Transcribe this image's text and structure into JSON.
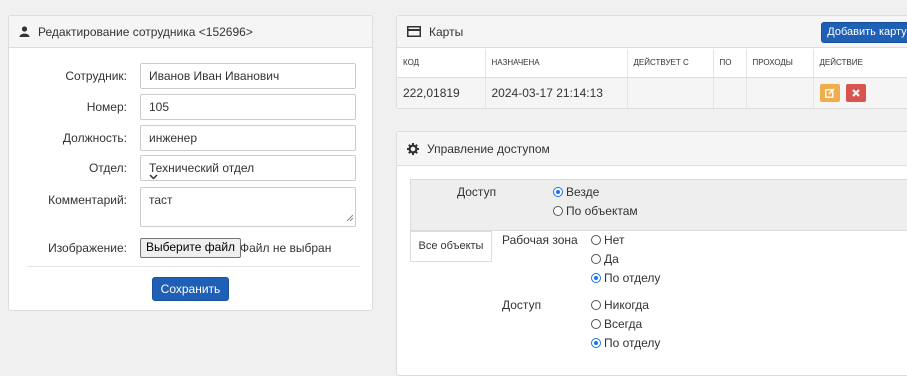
{
  "employee_form": {
    "title": "Редактирование сотрудника <152696>",
    "labels": {
      "employee": "Сотрудник:",
      "number": "Номер:",
      "position": "Должность:",
      "department": "Отдел:",
      "comment": "Комментарий:",
      "image": "Изображение:"
    },
    "values": {
      "employee": "Иванов Иван Иванович",
      "number": "105",
      "position": "инженер",
      "department": "Технический отдел",
      "comment": "таст"
    },
    "file_button": "Выберите файл",
    "file_status": "Файл не выбран",
    "save_button": "Сохранить"
  },
  "cards": {
    "title": "Карты",
    "add_button": "Добавить карту",
    "columns": [
      "КОД",
      "НАЗНАЧЕНА",
      "ДЕЙСТВУЕТ С",
      "ПО",
      "ПРОХОДЫ",
      "ДЕЙСТВИЕ"
    ],
    "rows": [
      {
        "code": "222,01819",
        "assigned": "2024-03-17 21:14:13",
        "valid_from": "",
        "valid_to": "",
        "passes": ""
      }
    ]
  },
  "access": {
    "title": "Управление доступом",
    "access_label": "Доступ",
    "scope_options": [
      "Везде",
      "По объектам"
    ],
    "scope_selected": "Везде",
    "all_objects_tab": "Все объекты",
    "work_zone_label": "Рабочая зона",
    "work_zone_options": [
      "Нет",
      "Да",
      "По отделу"
    ],
    "work_zone_selected": "По отделу",
    "access2_label": "Доступ",
    "access2_options": [
      "Никогда",
      "Всегда",
      "По отделу"
    ],
    "access2_selected": "По отделу"
  },
  "colors": {
    "primary": "#1f5fb5",
    "edit": "#f0ad4e",
    "delete": "#d9534f",
    "radio": "#1a73e8"
  }
}
